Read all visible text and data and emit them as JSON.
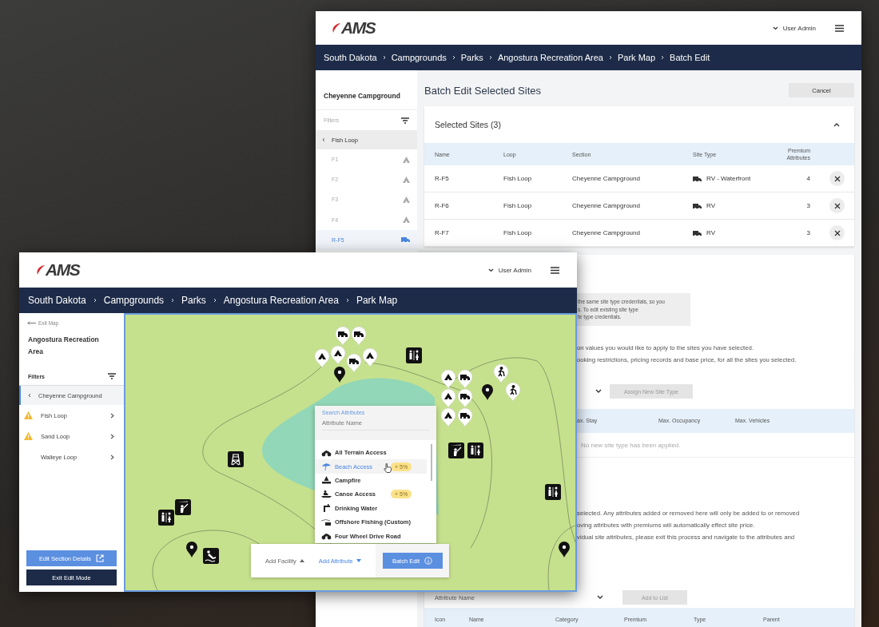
{
  "back_window": {
    "logo": "AMS",
    "user": "User Admin",
    "breadcrumb": [
      "South Dakota",
      "Campgrounds",
      "Parks",
      "Angostura Recreation Area",
      "Park Map",
      "Batch Edit"
    ],
    "sidebar": {
      "title": "Cheyenne Campground",
      "filters": "Filters",
      "parent": "Fish Loop",
      "items": [
        {
          "label": "F1",
          "kind": "tent",
          "selected": false
        },
        {
          "label": "F2",
          "kind": "tent",
          "selected": false
        },
        {
          "label": "F3",
          "kind": "tent",
          "selected": false
        },
        {
          "label": "F4",
          "kind": "tent",
          "selected": false
        },
        {
          "label": "R-F5",
          "kind": "rv",
          "selected": true
        }
      ]
    },
    "page_title": "Batch Edit Selected Sites",
    "cancel": "Cancel",
    "selected_sites": {
      "title": "Selected Sites (3)",
      "expanded": true,
      "columns": [
        "Name",
        "Loop",
        "Section",
        "Site Type",
        "Premium Attributes"
      ],
      "rows": [
        {
          "name": "R-F5",
          "loop": "Fish Loop",
          "section": "Cheyenne Campground",
          "site_type": "RV - Waterfront",
          "premium_attributes": "4"
        },
        {
          "name": "R-F6",
          "loop": "Fish Loop",
          "section": "Cheyenne Campground",
          "site_type": "RV",
          "premium_attributes": "3"
        },
        {
          "name": "R-F7",
          "loop": "Fish Loop",
          "section": "Cheyenne Campground",
          "site_type": "RV",
          "premium_attributes": "3"
        }
      ]
    },
    "site_type_section": {
      "note_lines": [
        "the same site type credentials, so you",
        "s. To edit existing site type",
        "te type credentials."
      ],
      "intro_lines": [
        "on values you would like to apply to the sites you have selected.",
        "ooking restrictions, pricing records and base price, for all the sites you selected."
      ],
      "assign_button": "Assign New Site Type",
      "columns": [
        "ax. Stay",
        "Max. Occupancy",
        "Max. Vehicles"
      ],
      "empty_text": "No new site type has been applied."
    },
    "attributes_section": {
      "intro_lines": [
        "selected. Any attributes added or removed here will only be added to or removed",
        "oving attributes with premiums will automatically effect site price.",
        "vidual site attributes, please exit this process and navigate to the attributes and"
      ],
      "select_placeholder": "Attribute Name",
      "add_button": "Add to List",
      "columns": [
        "Icon",
        "Name",
        "Category",
        "Premium",
        "Type",
        "Parent"
      ]
    }
  },
  "front_window": {
    "logo": "AMS",
    "user": "User Admin",
    "breadcrumb": [
      "South Dakota",
      "Campgrounds",
      "Parks",
      "Angostura Recreation Area",
      "Park Map"
    ],
    "sidebar": {
      "back_link": "Exit Map",
      "title": "Angostura Recreation Area",
      "filters": "Filters",
      "parent": "Cheyenne Campground",
      "items": [
        {
          "label": "Fish Loop",
          "warning": true
        },
        {
          "label": "Sand Loop",
          "warning": true
        },
        {
          "label": "Walleye Loop",
          "warning": false
        }
      ],
      "edit_button": "Edit Section Details",
      "exit_button": "Exit Edit Mode"
    },
    "attribute_menu": {
      "label": "Search Attributes",
      "placeholder": "Attribute Name",
      "items": [
        {
          "label": "All Terrain Access",
          "selected": false
        },
        {
          "label": "Beach Access",
          "selected": true,
          "badge": "+ 5%"
        },
        {
          "label": "Campfire",
          "selected": false
        },
        {
          "label": "Canoe Access",
          "selected": false,
          "badge": "+ 5%"
        },
        {
          "label": "Drinking Water",
          "selected": false
        },
        {
          "label": "Offshore Fishing (Custom)",
          "selected": false
        },
        {
          "label": "Four Wheel Drive Road",
          "selected": false
        }
      ]
    },
    "toolbar": {
      "menus": [
        {
          "label": "Add Facility",
          "selected": false
        },
        {
          "label": "Add Attribute",
          "selected": true
        }
      ],
      "batch_edit": "Batch Edit"
    }
  }
}
